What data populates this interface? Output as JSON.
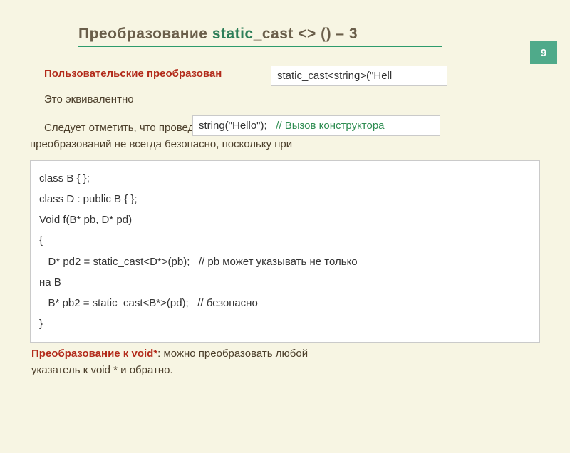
{
  "page_number": "9",
  "title": {
    "prefix": "Преобразование ",
    "keyword": "static",
    "suffix": "_cast <> () – 3"
  },
  "line1": {
    "subhead": "Пользовательские преобразован",
    "code": "static_cast<string>(\"Hell"
  },
  "line2": {
    "lead": "Это эквивалентно",
    "code": "string(\"Hello\");",
    "comment": "// Вызов конструктора"
  },
  "para": {
    "lead": "Следует отметить, что проведение подобных",
    "rest": "преобразований не всегда безопасно, поскольку при"
  },
  "code": {
    "l1": "class B { };",
    "l2": "class D : public B { };",
    "l3": "Void f(B* pb, D* pd)",
    "l4": "{",
    "l5": "   D* pd2 = static_cast<D*>(pb);   // pb может указывать не только",
    "l6": "на B",
    "l7": "   B* pb2 = static_cast<B*>(pd);   // безопасно",
    "l8": "}"
  },
  "final": {
    "red": "Преобразование к void*",
    "rest": ": можно преобразовать любой",
    "rest2": "указатель к void * и обратно."
  }
}
